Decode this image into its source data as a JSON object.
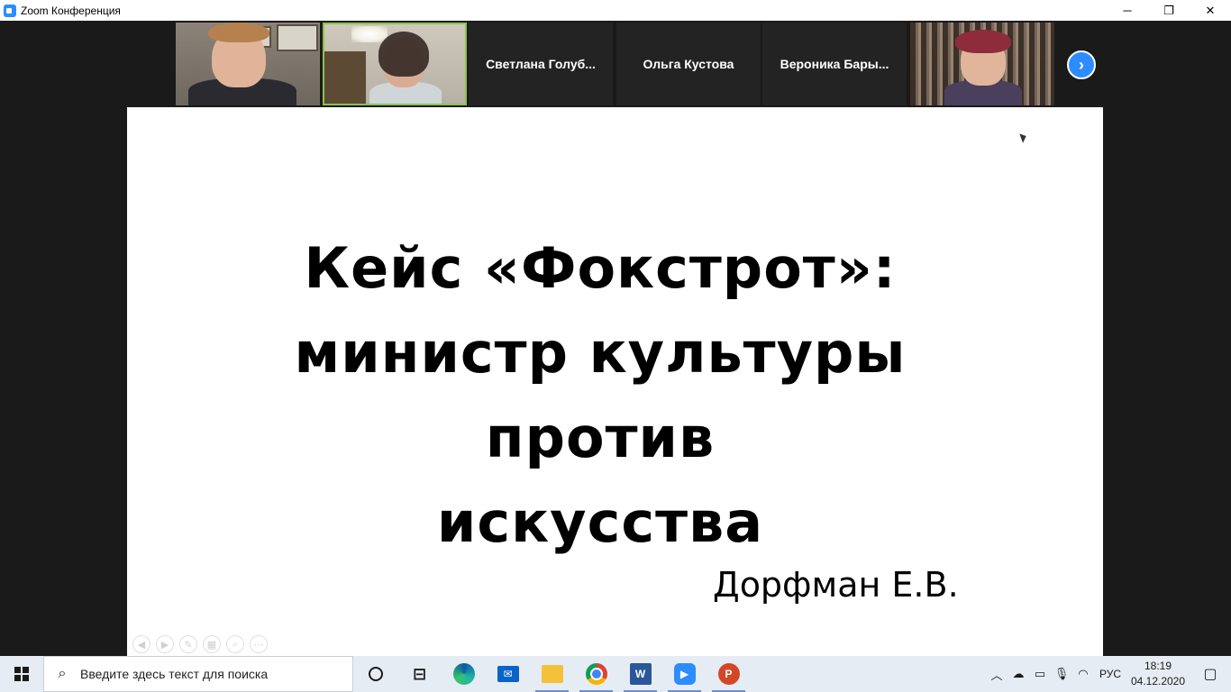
{
  "window": {
    "title": "Zoom Конференция"
  },
  "controls": {
    "minimize": "─",
    "maximize": "❐",
    "close": "✕"
  },
  "participants": [
    {
      "name": "Светлана  Голуб..."
    },
    {
      "name": "Ольга Кустова"
    },
    {
      "name": "Вероника  Бары..."
    }
  ],
  "slide": {
    "title_lines": [
      "Кейс «Фокстрот»:",
      "министр культуры",
      "против",
      "искусства"
    ],
    "author": "Дорфман Е.В."
  },
  "taskbar": {
    "search_placeholder": "Введите здесь текст для поиска",
    "apps": [
      "edge",
      "mail",
      "file-explorer",
      "chrome",
      "word",
      "zoom",
      "powerpoint"
    ],
    "tray": {
      "language": "РУС",
      "time": "18:19",
      "date": "04.12.2020"
    }
  },
  "colors": {
    "zoom_blue": "#2d8cff",
    "active_speaker": "#8bc34a",
    "taskbar": "#e6ecf3"
  }
}
